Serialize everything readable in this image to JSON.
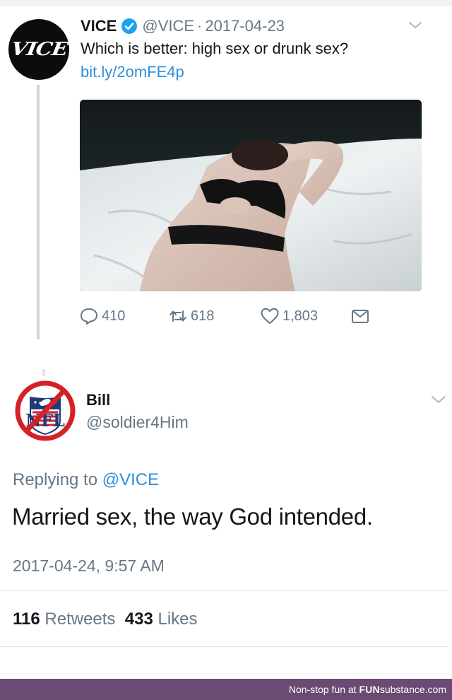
{
  "first_tweet": {
    "name": "VICE",
    "handle": "@VICE",
    "separator": "·",
    "date": "2017-04-23",
    "avatar_logo": "VICE",
    "text": "Which is better: high sex or drunk sex?",
    "link": "bit.ly/2omFE4p",
    "actions": {
      "replies": "410",
      "retweets": "618",
      "likes": "1,803"
    },
    "icons": [
      "verified-badge-icon",
      "chevron-down-icon",
      "reply-icon",
      "retweet-icon",
      "like-icon",
      "message-icon"
    ]
  },
  "reply_tweet": {
    "name": "Bill",
    "handle": "@soldier4Him",
    "avatar_logo": "NFL",
    "replying_prefix": "Replying to ",
    "replying_to": "@VICE",
    "text": "Married sex, the way God intended.",
    "timestamp": "2017-04-24, 9:57 AM",
    "retweets_count": "116",
    "retweets_label": "Retweets",
    "likes_count": "433",
    "likes_label": "Likes"
  },
  "footer": {
    "prefix": "Non-stop fun at ",
    "brand_bold": "FUN",
    "brand_rest": "substance",
    "brand_suffix": ".com"
  },
  "colors": {
    "link": "#2f8fd8",
    "muted": "#657786",
    "verified": "#1da1f2",
    "footer_bg": "#6b4a73"
  }
}
